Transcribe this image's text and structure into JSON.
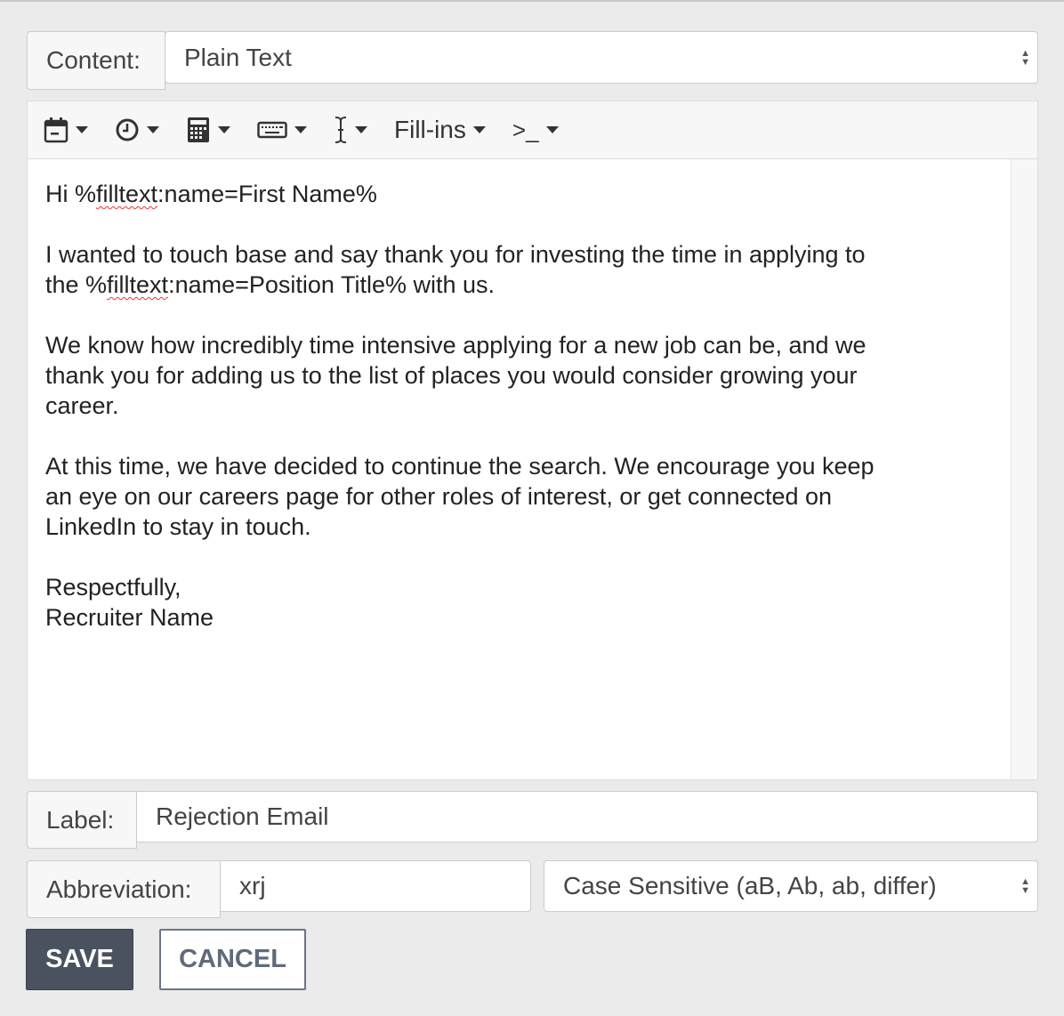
{
  "content": {
    "label": "Content:",
    "value": "Plain Text"
  },
  "toolbar": {
    "items": [
      {
        "icon": "calendar-icon"
      },
      {
        "icon": "clock-icon"
      },
      {
        "icon": "calculator-icon"
      },
      {
        "icon": "keyboard-icon"
      },
      {
        "icon": "text-cursor-icon"
      },
      {
        "label": "Fill-ins"
      },
      {
        "icon": "terminal-icon",
        "label": ">_"
      }
    ]
  },
  "editor": {
    "line1_pre": "Hi %",
    "line1_spell": "filltext",
    "line1_post": ":name=First Name%",
    "p2_pre": "I wanted to touch base and say thank you for investing the time in applying to\nthe %",
    "p2_spell": "filltext",
    "p2_post": ":name=Position Title% with us.",
    "p3": "We know how incredibly time intensive applying for a new job can be, and we\nthank you for adding us to the list of places you would consider growing your\ncareer.",
    "p4": "At this time, we have decided to continue the search. We encourage you keep\nan eye on our careers page for other roles of interest, or get connected on\nLinkedIn to stay in touch.",
    "p5": "Respectfully,\nRecruiter Name"
  },
  "label": {
    "label": "Label:",
    "value": "Rejection Email"
  },
  "abbreviation": {
    "label": "Abbreviation:",
    "value": "xrj",
    "case_option": "Case Sensitive (aB, Ab, ab, differ)"
  },
  "buttons": {
    "save": "SAVE",
    "cancel": "CANCEL"
  },
  "colors": {
    "save_bg": "#4a5260",
    "cancel_text": "#5f6b7a"
  }
}
